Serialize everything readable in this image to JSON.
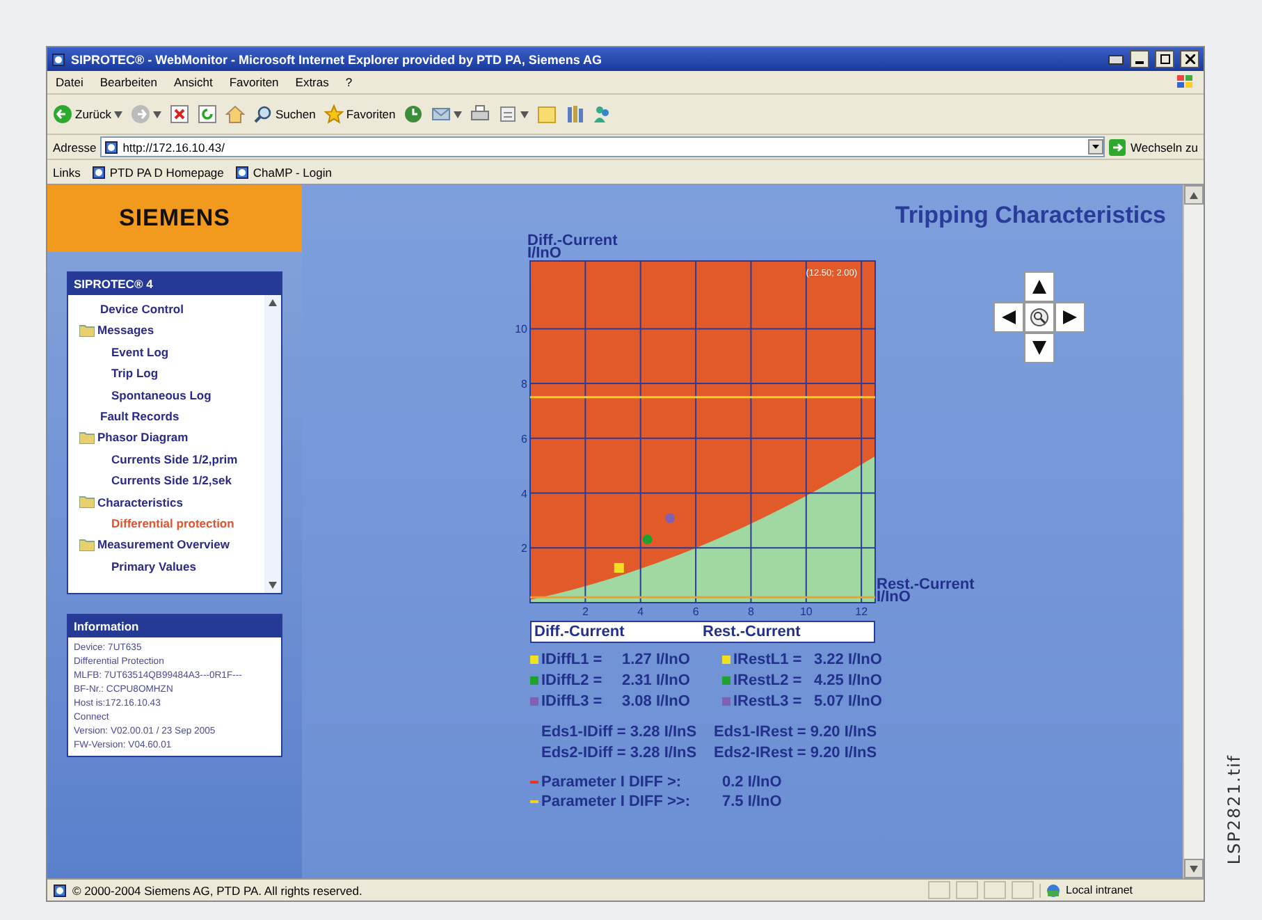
{
  "window": {
    "title": "SIPROTEC® - WebMonitor - Microsoft Internet Explorer provided by PTD PA, Siemens AG"
  },
  "menu": [
    "Datei",
    "Bearbeiten",
    "Ansicht",
    "Favoriten",
    "Extras",
    "?"
  ],
  "toolbar": [
    {
      "label": "Zurück",
      "caret": true
    },
    {
      "caret": true
    },
    {
      "caret": false
    },
    {
      "caret": false
    },
    {
      "caret": false
    },
    {
      "label": "Suchen",
      "caret": false
    },
    {
      "label": "Favoriten",
      "caret": false
    },
    {
      "caret": false
    },
    {
      "caret": true
    },
    {
      "caret": false
    },
    {
      "caret": true
    },
    {
      "caret": false
    },
    {
      "caret": false
    },
    {
      "caret": false
    }
  ],
  "address": {
    "label": "Adresse",
    "value": "http://172.16.10.43/",
    "go": "Wechseln zu"
  },
  "links": {
    "label": "Links",
    "items": [
      "PTD PA D Homepage",
      "ChaMP - Login"
    ]
  },
  "logo": "SIEMENS",
  "nav": {
    "title": "SIPROTEC® 4",
    "items": [
      {
        "label": "Device Control",
        "folder": false,
        "selected": false
      },
      {
        "label": "Messages",
        "folder": true,
        "selected": false,
        "children": [
          {
            "label": "Event Log",
            "folder": false,
            "selected": false
          },
          {
            "label": "Trip Log",
            "folder": false,
            "selected": false
          },
          {
            "label": "Spontaneous Log",
            "folder": false,
            "selected": false
          }
        ]
      },
      {
        "label": "Fault Records",
        "folder": false,
        "selected": false
      },
      {
        "label": "Phasor Diagram",
        "folder": true,
        "selected": false,
        "children": [
          {
            "label": "Currents Side 1/2,prim",
            "folder": false,
            "selected": false
          },
          {
            "label": "Currents Side 1/2,sek",
            "folder": false,
            "selected": false
          }
        ]
      },
      {
        "label": "Characteristics",
        "folder": true,
        "selected": false,
        "children": [
          {
            "label": "Differential protection",
            "folder": false,
            "selected": true
          }
        ]
      },
      {
        "label": "Measurement Overview",
        "folder": true,
        "selected": false,
        "children": [
          {
            "label": "Primary Values",
            "folder": false,
            "selected": false
          }
        ]
      }
    ]
  },
  "info": {
    "title": "Information",
    "lines": [
      "Device: 7UT635",
      "Differential Protection",
      "MLFB: 7UT63514QB99484A3---0R1F---",
      "BF-Nr.: CCPU8OMHZN",
      "Host is:172.16.10.43",
      "Connect",
      "Version: V02.00.01 / 23 Sep 2005",
      "FW-Version: V04.60.01"
    ]
  },
  "page_title": "Tripping Characteristics",
  "chart": {
    "ylabel_lines": [
      "Diff.-Current",
      "I/InO"
    ],
    "xlabel_lines": [
      "Rest.-Current",
      "I/InO"
    ],
    "chart_data": {
      "type": "scatter",
      "x": [
        3.22,
        4.25,
        5.07
      ],
      "series": [
        {
          "color": "#f0e020",
          "values": [
            1.27,
            null,
            null
          ]
        },
        {
          "color": "#20a030",
          "values": [
            null,
            2.31,
            null
          ]
        },
        {
          "color": "#8060b0",
          "values": [
            null,
            null,
            3.08
          ]
        }
      ],
      "xlim": [
        0,
        12.5
      ],
      "ylim": [
        0,
        12.5
      ],
      "xticks": [
        2,
        4,
        6,
        8,
        10,
        12
      ],
      "yticks": [
        2,
        4,
        6,
        8,
        10
      ],
      "grid": true,
      "ref_lines": [
        {
          "axis": "y",
          "value": 7.5,
          "color": "#f0d020"
        },
        {
          "axis": "y",
          "value": 0.2,
          "color": "#f0a030"
        }
      ],
      "annotations": [
        {
          "text": "(12.50; 2.00)"
        }
      ]
    }
  },
  "legend": {
    "diff": "Diff.-Current",
    "rest": "Rest.-Current"
  },
  "readings": [
    {
      "color": "#f0e020",
      "diff_label": "IDiffL1 =",
      "diff_value": "1.27 I/InO",
      "rest_label": "IRestL1 =",
      "rest_value": "3.22 I/InO"
    },
    {
      "color": "#20a030",
      "diff_label": "IDiffL2 =",
      "diff_value": "2.31 I/InO",
      "rest_label": "IRestL2 =",
      "rest_value": "4.25 I/InO"
    },
    {
      "color": "#8060b0",
      "diff_label": "IDiffL3 =",
      "diff_value": "3.08 I/InO",
      "rest_label": "IRestL3 =",
      "rest_value": "5.07 I/InO"
    }
  ],
  "eds": [
    {
      "diff": "Eds1-IDiff = 3.28 I/InS",
      "rest": "Eds1-IRest = 9.20 I/InS"
    },
    {
      "diff": "Eds2-IDiff = 3.28 I/InS",
      "rest": "Eds2-IRest = 9.20 I/InS"
    }
  ],
  "parameters": [
    {
      "color": "#f03020",
      "label": "Parameter I DIFF >:",
      "value": "0.2 I/InO"
    },
    {
      "color": "#f0d020",
      "label": "Parameter I DIFF >>:",
      "value": "7.5 I/InO"
    }
  ],
  "status": {
    "text": "© 2000-2004 Siemens AG, PTD PA. All rights reserved.",
    "zone": "Local intranet"
  },
  "caption": "LSP2821.tif"
}
